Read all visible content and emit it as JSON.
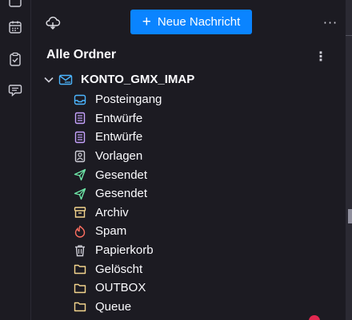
{
  "spaces_bar": {
    "items": [
      {
        "icon": "calendar-icon"
      },
      {
        "icon": "tasks-icon"
      },
      {
        "icon": "chat-icon"
      }
    ]
  },
  "header": {
    "sync_icon": "cloud-sync-icon",
    "new_message_plus": "+",
    "new_message_label": "Neue Nachricht",
    "menu_label": "···"
  },
  "tree": {
    "title": "Alle Ordner",
    "menu_label": "⋮",
    "account": {
      "name": "KONTO_GMX_IMAP",
      "icon": "mail-account-icon"
    },
    "folders": [
      {
        "name": "Posteingang",
        "icon": "inbox-icon",
        "color": "#4cb6ff"
      },
      {
        "name": "Entwürfe",
        "icon": "drafts-icon",
        "color": "#c7a3ff"
      },
      {
        "name": "Entwürfe",
        "icon": "drafts-icon",
        "color": "#c7a3ff"
      },
      {
        "name": "Vorlagen",
        "icon": "templates-icon",
        "color": "#cfcfd8"
      },
      {
        "name": "Gesendet",
        "icon": "sent-icon",
        "color": "#6ee7a8"
      },
      {
        "name": "Gesendet",
        "icon": "sent-icon",
        "color": "#6ee7a8"
      },
      {
        "name": "Archiv",
        "icon": "archive-icon",
        "color": "#f4d58d"
      },
      {
        "name": "Spam",
        "icon": "spam-icon",
        "color": "#ff6f61"
      },
      {
        "name": "Papierkorb",
        "icon": "trash-icon",
        "color": "#cfcfd8"
      },
      {
        "name": "Gelöscht",
        "icon": "folder-icon",
        "color": "#f4d58d"
      },
      {
        "name": "OUTBOX",
        "icon": "folder-icon",
        "color": "#f4d58d"
      },
      {
        "name": "Queue",
        "icon": "folder-icon",
        "color": "#f4d58d"
      }
    ]
  },
  "colors": {
    "background": "#1c1b22",
    "accent": "#0a84ff",
    "text": "#fbfbfe"
  }
}
